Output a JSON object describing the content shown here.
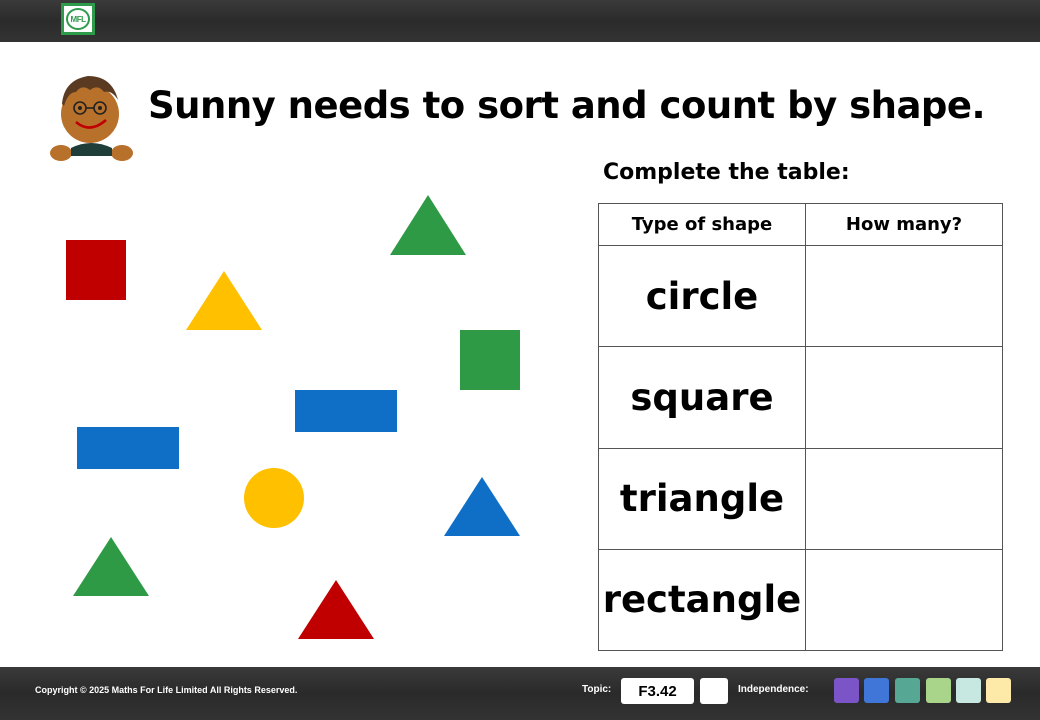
{
  "header": {
    "logo_text": "MFL"
  },
  "title": "Sunny needs to sort and count by shape.",
  "instruction": "Complete the table:",
  "table": {
    "headers": [
      "Type of shape",
      "How many?"
    ],
    "rows": [
      {
        "shape": "circle",
        "count": ""
      },
      {
        "shape": "square",
        "count": ""
      },
      {
        "shape": "triangle",
        "count": ""
      },
      {
        "shape": "rectangle",
        "count": ""
      }
    ]
  },
  "shapes": [
    {
      "type": "square",
      "color": "#c00000"
    },
    {
      "type": "triangle",
      "color": "#ffc000"
    },
    {
      "type": "triangle",
      "color": "#2e9a45"
    },
    {
      "type": "square",
      "color": "#2e9a45"
    },
    {
      "type": "rectangle",
      "color": "#0f6fc6"
    },
    {
      "type": "rectangle",
      "color": "#0f6fc6"
    },
    {
      "type": "circle",
      "color": "#ffc000"
    },
    {
      "type": "triangle",
      "color": "#0f6fc6"
    },
    {
      "type": "triangle",
      "color": "#2e9a45"
    },
    {
      "type": "triangle",
      "color": "#c00000"
    }
  ],
  "footer": {
    "copyright": "Copyright © 2025 Maths For Life Limited All Rights Reserved.",
    "topic_label": "Topic:",
    "topic_code": "F3.42",
    "independence_label": "Independence:",
    "independence_colors": [
      "#7b55c7",
      "#3f76d8",
      "#56a895",
      "#a8d58a",
      "#c6e8e0",
      "#fde9a8"
    ]
  }
}
